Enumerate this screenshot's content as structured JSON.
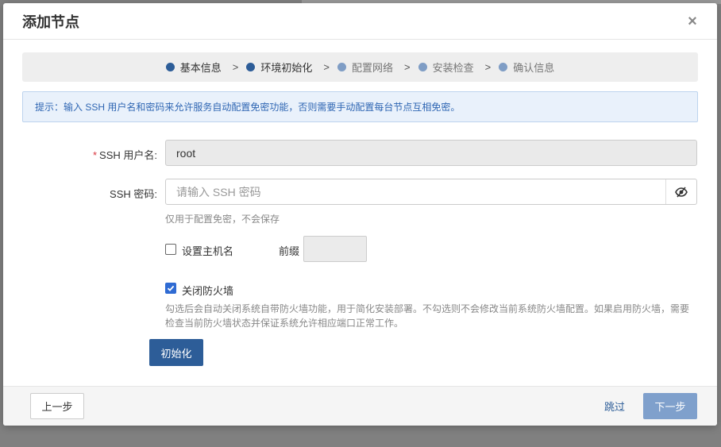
{
  "dialog": {
    "title": "添加节点",
    "close_icon": "close-icon"
  },
  "steps": [
    {
      "label": "基本信息",
      "state": "done"
    },
    {
      "label": "环境初始化",
      "state": "current"
    },
    {
      "label": "配置网络",
      "state": "pending"
    },
    {
      "label": "安装检查",
      "state": "pending"
    },
    {
      "label": "确认信息",
      "state": "pending"
    }
  ],
  "step_separator": ">",
  "hint": "提示：输入 SSH 用户名和密码来允许服务自动配置免密功能，否则需要手动配置每台节点互相免密。",
  "form": {
    "username": {
      "required_mark": "*",
      "label": "SSH 用户名:",
      "value": "root"
    },
    "password": {
      "label": "SSH 密码:",
      "placeholder": "请输入 SSH 密码",
      "help": "仅用于配置免密，不会保存",
      "toggle_icon": "eye-slash-icon"
    },
    "set_hostname": {
      "label": "设置主机名",
      "checked": false,
      "prefix_label": "前缀",
      "prefix_value": ""
    },
    "disable_firewall": {
      "label": "关闭防火墙",
      "checked": true,
      "help_line1": "勾选后会自动关闭系统自带防火墙功能，用于简化安装部署。不勾选则不会修改当前系统防火墙配置。如果启用防火墙，需要",
      "help_line2": "检查当前防火墙状态并保证系统允许相应端口正常工作。"
    },
    "init_button": "初始化"
  },
  "footer": {
    "prev": "上一步",
    "skip": "跳过",
    "next": "下一步"
  },
  "colors": {
    "primary": "#2d5d98",
    "primary_disabled": "#7fa0cc",
    "hint_bg": "#e9f1fb",
    "hint_text": "#2f66b3",
    "required": "#d9363e",
    "checkbox_checked": "#2f6bd3"
  }
}
